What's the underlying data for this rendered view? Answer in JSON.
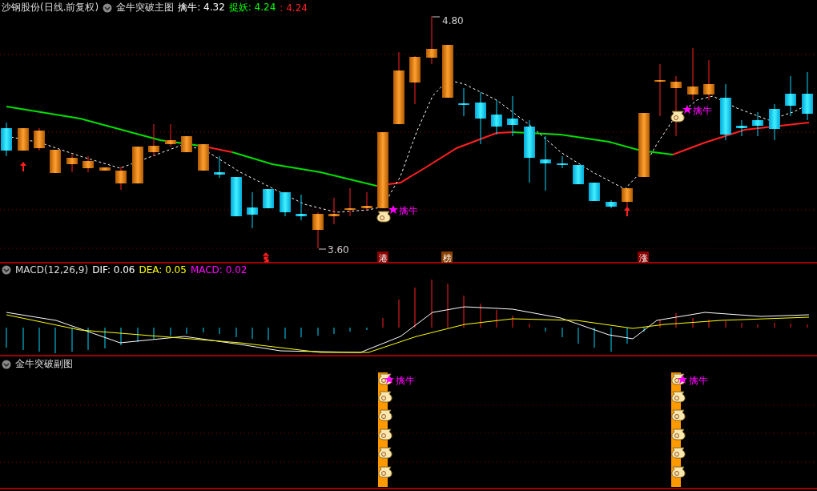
{
  "main_chart": {
    "title": "沙钢股份(日线.前复权)",
    "indicator": "金牛突破主图",
    "readings": [
      {
        "label": "擒牛:",
        "value": "4.32",
        "color": "#ffffff"
      },
      {
        "label": "捉妖:",
        "value": "4.24",
        "color": "#00ff00"
      },
      {
        "label": ":",
        "value": "4.24",
        "color": "#ff2020"
      }
    ],
    "price_marks": [
      "4.80",
      "3.60"
    ],
    "signals": [
      "擒牛",
      "擒牛"
    ],
    "event_badges": [
      {
        "text": "港",
        "color": "#8b0000"
      },
      {
        "text": "榜",
        "color": "#8b4000"
      },
      {
        "text": "涨",
        "color": "#8b0000"
      }
    ]
  },
  "macd_chart": {
    "title": "MACD(12,26,9)",
    "readings": [
      {
        "text": "DIF: 0.06",
        "color": "#ffffff"
      },
      {
        "text": "DEA: 0.05",
        "color": "#ffff00"
      },
      {
        "text": "MACD: 0.02",
        "color": "#ff00ff"
      }
    ]
  },
  "sub_chart": {
    "title": "金牛突破副图",
    "signals": [
      "擒牛",
      "擒牛"
    ]
  }
}
